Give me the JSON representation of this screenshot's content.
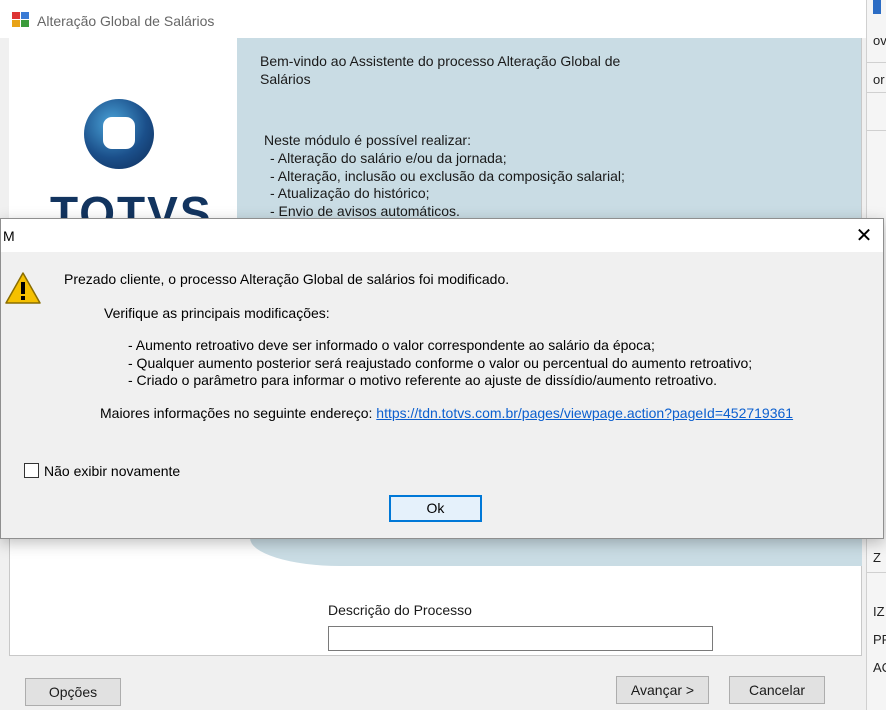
{
  "wizard": {
    "title": "Alteração Global de Salários",
    "logo_text": "TOTVS",
    "welcome": "Bem-vindo ao Assistente do processo Alteração Global de Salários",
    "module_intro": "Neste módulo é possível realizar:",
    "features": [
      "- Alteração do salário e/ou da jornada;",
      "- Alteração, inclusão ou exclusão da composição salarial;",
      "- Atualização do histórico;",
      "- Envio de avisos automáticos."
    ],
    "description_label": "Descrição do Processo",
    "description_value": "",
    "buttons": {
      "options": "Opções",
      "next": "Avançar >",
      "cancel": "Cancelar"
    }
  },
  "background_edge": {
    "fragments": [
      "ov",
      "or",
      "Z",
      "IZ",
      "PR",
      "AC"
    ]
  },
  "dialog": {
    "title": "M",
    "main_message": "Prezado cliente, o processo Alteração Global de salários foi modificado.",
    "verify": "Verifique as principais modificações:",
    "changes": [
      "- Aumento retroativo deve ser informado o valor correspondente ao salário da época;",
      "- Qualquer aumento posterior será reajustado conforme o valor ou percentual do aumento retroativo;",
      "- Criado o parâmetro para informar o motivo referente ao ajuste de dissídio/aumento retroativo."
    ],
    "more_info_label": "Maiores informações no seguinte endereço:",
    "more_info_link": "https://tdn.totvs.com.br/pages/viewpage.action?pageId=452719361",
    "dont_show_label": "Não exibir novamente",
    "dont_show_checked": false,
    "ok_label": "Ok",
    "icons": {
      "warning": "warning-icon",
      "close": "close-icon"
    },
    "colors": {
      "link": "#0b5fcf",
      "ok_border": "#0078d7",
      "warning": "#f5c000"
    }
  }
}
